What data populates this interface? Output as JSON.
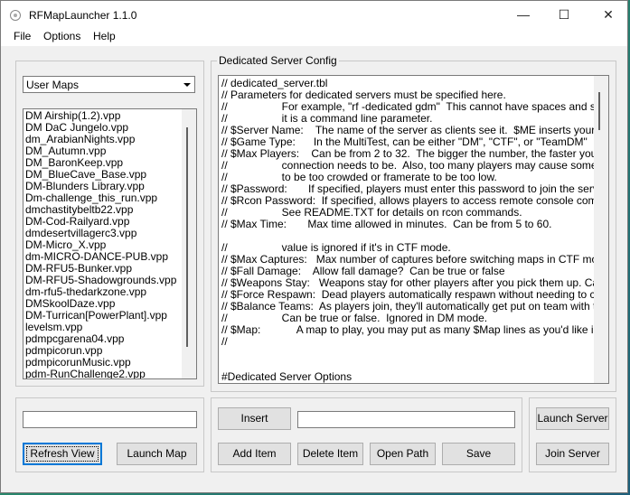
{
  "window": {
    "title": "RFMapLauncher 1.1.0"
  },
  "titlebar": {
    "minimize": "—",
    "maximize": "☐",
    "close": "✕"
  },
  "menu": [
    "File",
    "Options",
    "Help"
  ],
  "map_group": {
    "combo_value": "User Maps",
    "items": [
      "DM Airship(1.2).vpp",
      "DM DaC Jungelo.vpp",
      "dm_ArabianNights.vpp",
      "DM_Autumn.vpp",
      "DM_BaronKeep.vpp",
      "DM_BlueCave_Base.vpp",
      "DM-Blunders Library.vpp",
      "Dm-challenge_this_run.vpp",
      "dmchastitybeltb22.vpp",
      "DM-Cod-Railyard.vpp",
      "dmdesertvillagerc3.vpp",
      "DM-Micro_X.vpp",
      "dm-MICRO-DANCE-PUB.vpp",
      "DM-RFU5-Bunker.vpp",
      "DM-RFU5-Shadowgrounds.vpp",
      "dm-rfu5-thedarkzone.vpp",
      "DMSkoolDaze.vpp",
      "DM-Turrican[PowerPlant].vpp",
      "levelsm.vpp",
      "pdmpcgarena04.vpp",
      "pdmpicorun.vpp",
      "pdmpicorunMusic.vpp",
      "pdm-RunChallenge2.vpp"
    ]
  },
  "config_group": {
    "label": "Dedicated Server Config",
    "lines": [
      "// dedicated_server.tbl",
      "// Parameters for dedicated servers must be specified here.",
      "//                  For example, \"rf -dedicated gdm\"  This cannot have spaces and such sinc",
      "//                  it is a command line parameter.",
      "// $Server Name:    The name of the server as clients see it.  $ME inserts your Windows",
      "// $Game Type:      In the MultiTest, can be either \"DM\", \"CTF\", or \"TeamDM\"",
      "// $Max Players:    Can be from 2 to 32.  The bigger the number, the faster your Interne",
      "//                  connection needs to be.  Also, too many players may cause some maps",
      "//                  to be too crowded or framerate to be too low.",
      "// $Password:       If specified, players must enter this password to join the server.",
      "// $Rcon Password:  If specified, allows players to access remote console commands o",
      "//                  See README.TXT for details on rcon commands.",
      "// $Max Time:       Max time allowed in minutes.  Can be from 5 to 60.",
      "",
      "//                  value is ignored if it's in CTF mode.",
      "// $Max Captures:   Max number of captures before switching maps in CTF mode.  Can",
      "// $Fall Damage:    Allow fall damage?  Can be true or false",
      "// $Weapons Stay:   Weapons stay for other players after you pick them up. Can be tru",
      "// $Force Respawn:  Dead players automatically respawn without needing to click.  Can",
      "// $Balance Teams:  As players join, they'll automatically get put on team with the fewes",
      "//                  Can be true or false.  Ignored in DM mode.",
      "// $Map:            A map to play, you may put as many $Map lines as you'd like in.  You m",
      "//",
      "",
      "",
      "#Dedicated Server Options"
    ]
  },
  "buttons": {
    "refresh_view": "Refresh View",
    "launch_map": "Launch Map",
    "insert": "Insert",
    "add_item": "Add Item",
    "delete_item": "Delete Item",
    "open_path": "Open Path",
    "save": "Save",
    "launch_server": "Launch Server",
    "join_server": "Join Server"
  }
}
